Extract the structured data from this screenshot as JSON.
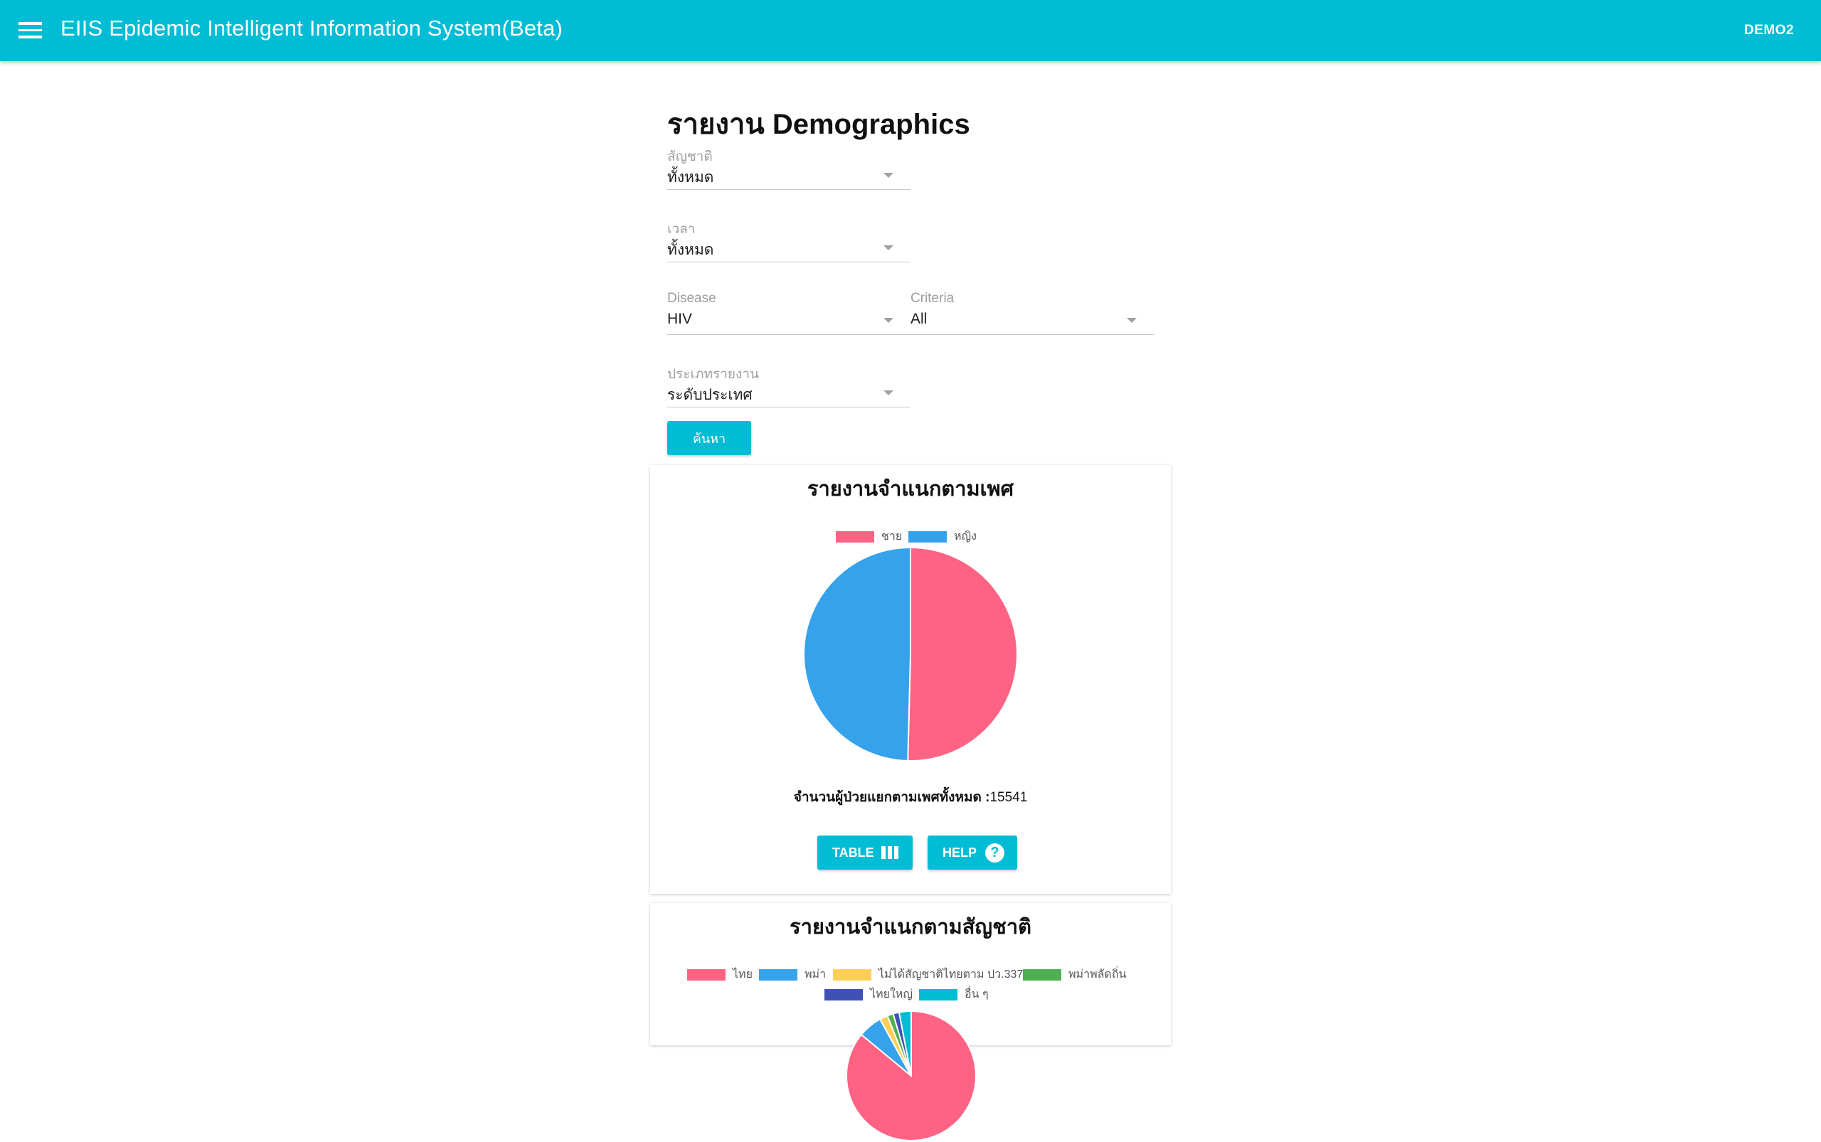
{
  "header": {
    "title": "EIIS Epidemic Intelligent Information System(Beta)",
    "user": "DEMO2",
    "bg_color": "#00bcd4"
  },
  "page": {
    "title": "รายงาน Demographics"
  },
  "filters": {
    "nationality": {
      "label": "สัญชาติ",
      "value": "ทั้งหมด"
    },
    "time": {
      "label": "เวลา",
      "value": "ทั้งหมด"
    },
    "disease": {
      "label": "Disease",
      "value": "HIV"
    },
    "criteria": {
      "label": "Criteria",
      "value": "All"
    },
    "report_type": {
      "label": "ประเภทรายงาน",
      "value": "ระดับประเทศ"
    },
    "search_label": "ค้นหา"
  },
  "gender_card": {
    "title": "รายงานจำแนกตามเพศ",
    "total_label": "จำนวนผู้ป่วยแยกตามเพศทั้งหมด :",
    "total_value": "15541",
    "table_label": "TABLE",
    "help_label": "HELP",
    "help_glyph": "?"
  },
  "nationality_card": {
    "title": "รายงานจำแนกตามสัญชาติ"
  },
  "chart_data": [
    {
      "type": "pie",
      "categories": [
        "ชาย",
        "หญิง"
      ],
      "values": [
        50.4,
        49.6
      ],
      "colors": [
        "#ff6384",
        "#36a2eb"
      ],
      "legend": "top"
    },
    {
      "type": "pie",
      "categories": [
        "ไทย",
        "พม่า",
        "ไม่ได้สัญชาติไทยตาม ปว.337",
        "พม่าพลัดถิ่น",
        "ไทยใหญ่",
        "อื่น ๆ"
      ],
      "values": [
        86,
        6,
        2,
        1.5,
        1.5,
        3
      ],
      "colors": [
        "#ff6384",
        "#36a2eb",
        "#ffce56",
        "#4caf50",
        "#3f51b5",
        "#00bcd4"
      ],
      "legend": "top"
    }
  ]
}
